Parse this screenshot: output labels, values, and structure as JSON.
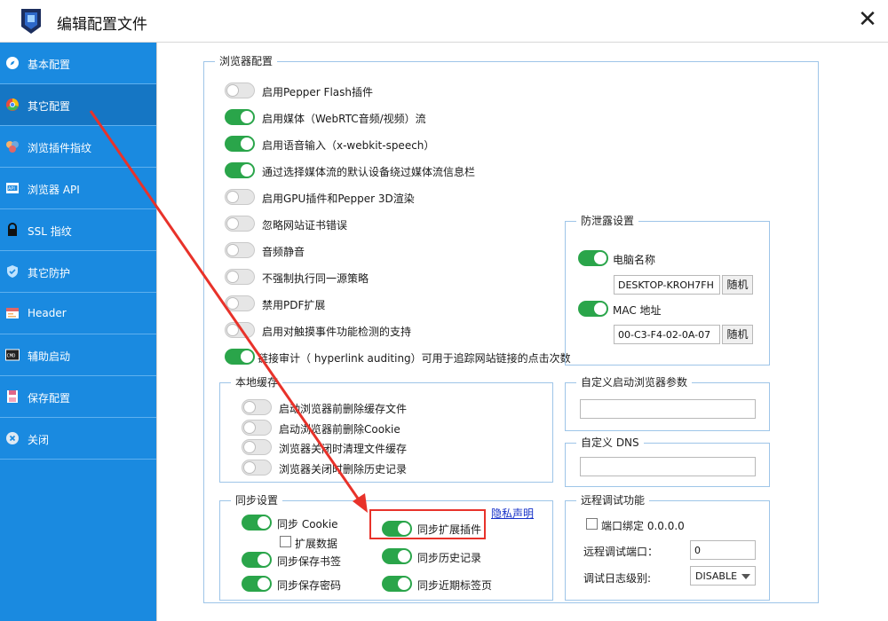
{
  "window": {
    "title": "编辑配置文件",
    "close_glyph": "✕"
  },
  "sidebar": {
    "items": [
      {
        "label": "基本配置",
        "icon": "compass-icon"
      },
      {
        "label": "其它配置",
        "icon": "chrome-icon",
        "active": true
      },
      {
        "label": "浏览插件指纹",
        "icon": "plugin-icon"
      },
      {
        "label": "浏览器 API",
        "icon": "api-icon"
      },
      {
        "label": "SSL 指纹",
        "icon": "lock-icon"
      },
      {
        "label": "其它防护",
        "icon": "shield-icon"
      },
      {
        "label": "Header",
        "icon": "header-icon"
      },
      {
        "label": "辅助启动",
        "icon": "cmd-icon"
      },
      {
        "label": "保存配置",
        "icon": "save-icon"
      },
      {
        "label": "关闭",
        "icon": "close-circle-icon"
      }
    ]
  },
  "browser_config": {
    "title": "浏览器配置",
    "options": [
      {
        "label": "启用Pepper Flash插件",
        "on": false
      },
      {
        "label": "启用媒体（WebRTC音频/视频）流",
        "on": true
      },
      {
        "label": "启用语音输入（x-webkit-speech）",
        "on": true
      },
      {
        "label": "通过选择媒体流的默认设备绕过媒体流信息栏",
        "on": true
      },
      {
        "label": "启用GPU插件和Pepper 3D渲染",
        "on": false
      },
      {
        "label": "忽略网站证书错误",
        "on": false
      },
      {
        "label": "音频静音",
        "on": false
      },
      {
        "label": "不强制执行同一源策略",
        "on": false
      },
      {
        "label": "禁用PDF扩展",
        "on": false
      },
      {
        "label": "启用对触摸事件功能检测的支持",
        "on": false
      },
      {
        "label": "链接审计（ hyperlink auditing）可用于追踪网站链接的点击次数",
        "on": true
      }
    ]
  },
  "anti_leak": {
    "title": "防泄露设置",
    "computer_name_label": "电脑名称",
    "computer_name_on": true,
    "computer_name_value": "DESKTOP-KROH7FH",
    "random_label": "随机",
    "mac_label": "MAC 地址",
    "mac_on": true,
    "mac_value": "00-C3-F4-02-0A-07"
  },
  "local_cache": {
    "title": "本地缓存",
    "options": [
      {
        "label": "启动浏览器前删除缓存文件",
        "on": false
      },
      {
        "label": "启动浏览器前删除Cookie",
        "on": false
      },
      {
        "label": "浏览器关闭时清理文件缓存",
        "on": false
      },
      {
        "label": "浏览器关闭时删除历史记录",
        "on": false
      }
    ]
  },
  "custom_args": {
    "title": "自定义启动浏览器参数",
    "value": ""
  },
  "custom_dns": {
    "title": "自定义 DNS",
    "value": ""
  },
  "sync": {
    "title": "同步设置",
    "privacy_link": "隐私声明",
    "cookie_label": "同步 Cookie",
    "cookie_on": true,
    "ext_data_label": "扩展数据",
    "ext_data_checked": false,
    "ext_plugin_label": "同步扩展插件",
    "ext_plugin_on": true,
    "bookmarks_label": "同步保存书签",
    "bookmarks_on": true,
    "history_label": "同步历史记录",
    "history_on": true,
    "passwords_label": "同步保存密码",
    "passwords_on": true,
    "recent_tabs_label": "同步近期标签页",
    "recent_tabs_on": true
  },
  "remote_debug": {
    "title": "远程调试功能",
    "port_bind_label": "端口绑定 0.0.0.0",
    "port_bind_checked": false,
    "port_label": "远程调试端口：",
    "port_value": "0",
    "log_level_label": "调试日志级别:",
    "log_level_value": "DISABLE"
  },
  "colors": {
    "sidebar": "#1a8ae0",
    "toggle_on": "#2aa54a",
    "annotation": "#e8322a"
  }
}
